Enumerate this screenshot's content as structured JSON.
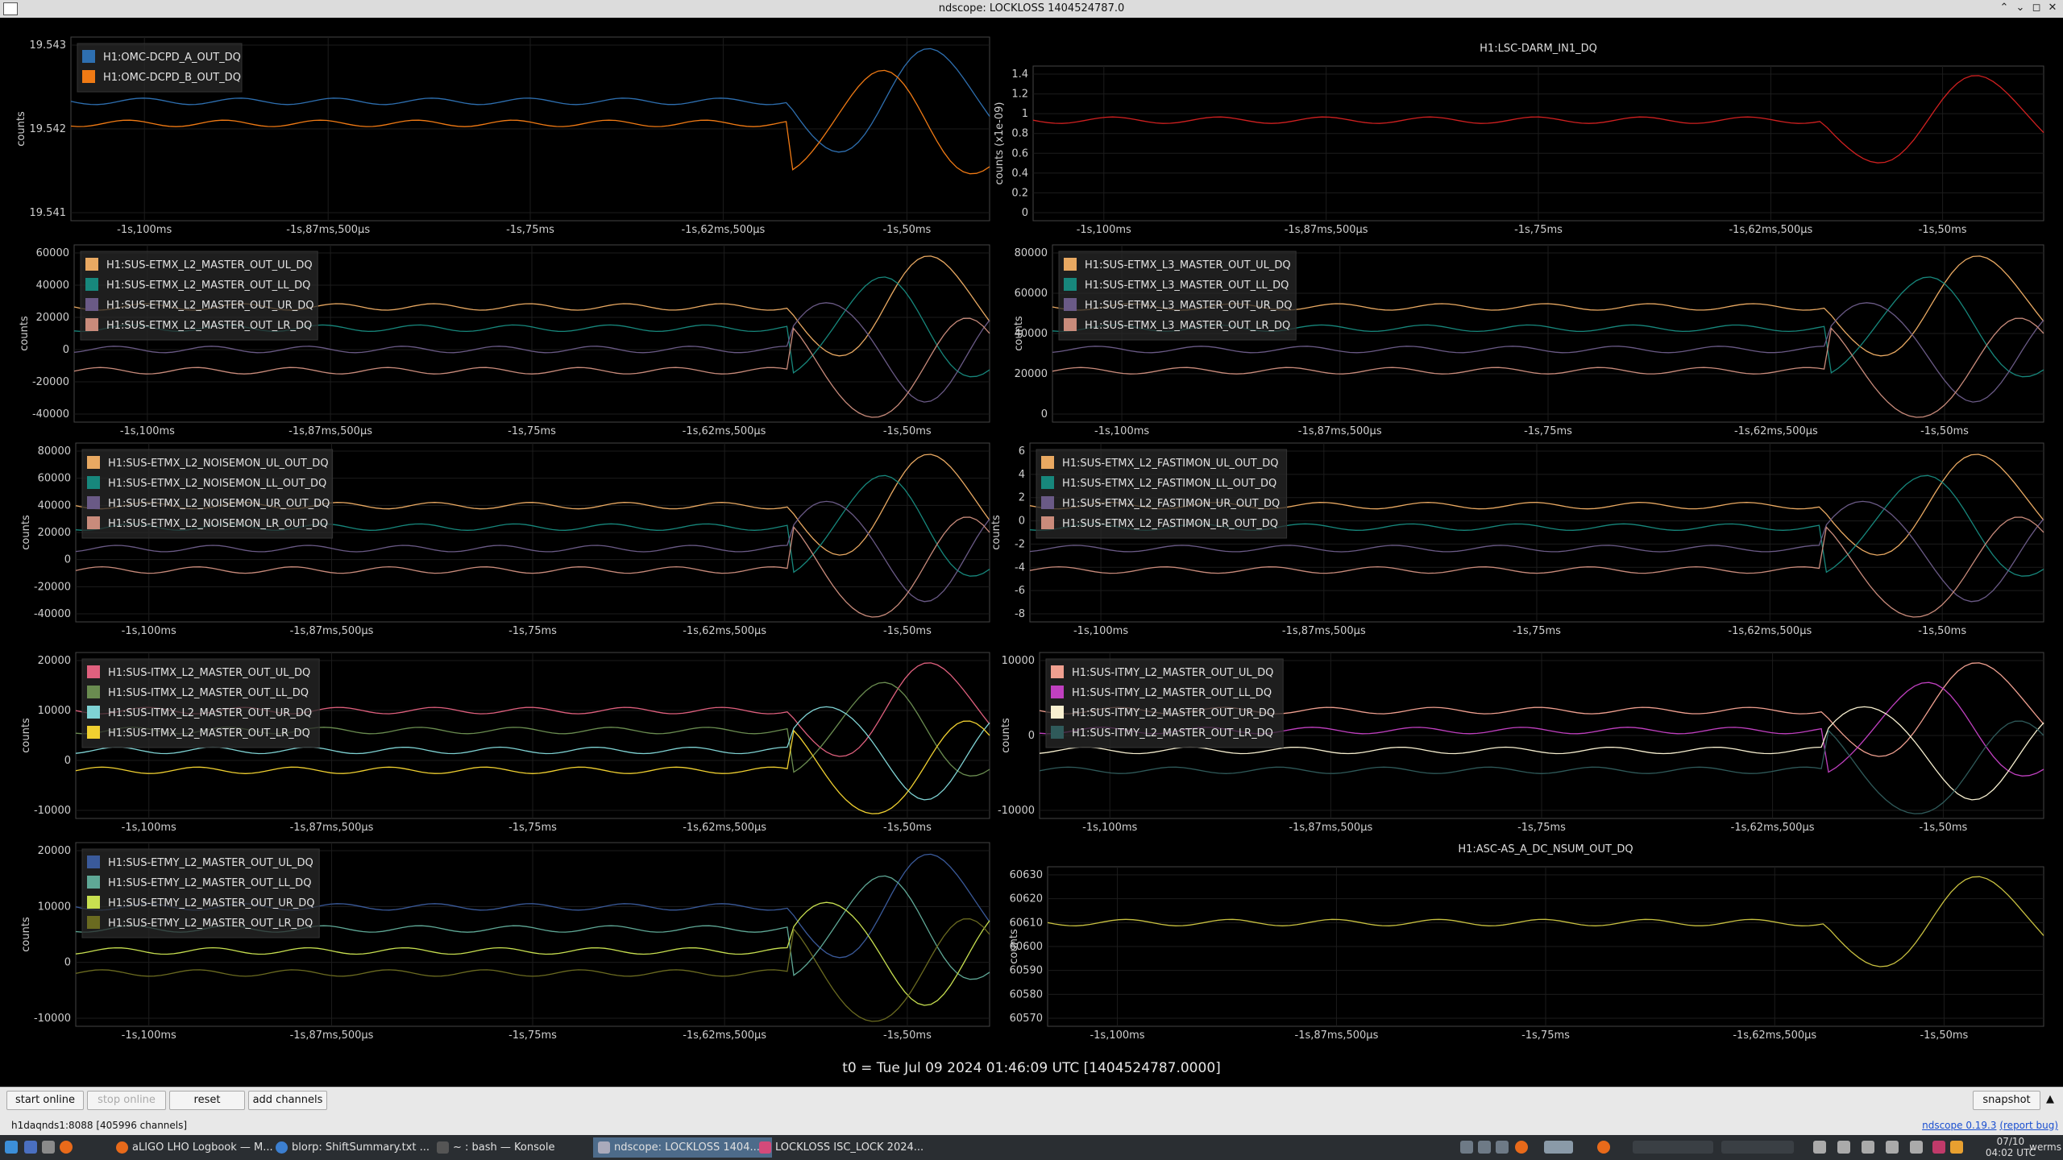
{
  "window": {
    "title": "ndscope: LOCKLOSS 1404524787.0"
  },
  "x_ticks": [
    "-1s,100ms",
    "-1s,87ms,500µs",
    "-1s,75ms",
    "-1s,62ms,500µs",
    "-1s,50ms"
  ],
  "ylabel": "counts",
  "ylabel_scaled": "counts (x1e-09)",
  "plots": [
    {
      "id": "omc-dcpd",
      "title": "",
      "ylabel": "counts",
      "yticks": [
        "19.543",
        "19.542",
        "19.541"
      ],
      "legend": [
        {
          "name": "H1:OMC-DCPD_A_OUT_DQ",
          "color": "#2e6fb0"
        },
        {
          "name": "H1:OMC-DCPD_B_OUT_DQ",
          "color": "#f07a14"
        }
      ]
    },
    {
      "id": "lsc-darm",
      "title": "H1:LSC-DARM_IN1_DQ",
      "ylabel": "counts (x1e-09)",
      "yticks": [
        "1.4",
        "1.2",
        "1",
        "0.8",
        "0.6",
        "0.4",
        "0.2",
        "0"
      ],
      "legend": []
    },
    {
      "id": "etmx-l2-master",
      "title": "",
      "ylabel": "counts",
      "yticks": [
        "60000",
        "40000",
        "20000",
        "0",
        "-20000",
        "-40000"
      ],
      "legend": [
        {
          "name": "H1:SUS-ETMX_L2_MASTER_OUT_UL_DQ",
          "color": "#e9a962"
        },
        {
          "name": "H1:SUS-ETMX_L2_MASTER_OUT_LL_DQ",
          "color": "#17877c"
        },
        {
          "name": "H1:SUS-ETMX_L2_MASTER_OUT_UR_DQ",
          "color": "#6a5a86"
        },
        {
          "name": "H1:SUS-ETMX_L2_MASTER_OUT_LR_DQ",
          "color": "#c98b7b"
        }
      ]
    },
    {
      "id": "etmx-l3-master",
      "title": "",
      "ylabel": "counts",
      "yticks": [
        "80000",
        "60000",
        "40000",
        "20000",
        "0"
      ],
      "legend": [
        {
          "name": "H1:SUS-ETMX_L3_MASTER_OUT_UL_DQ",
          "color": "#e9a962"
        },
        {
          "name": "H1:SUS-ETMX_L3_MASTER_OUT_LL_DQ",
          "color": "#17877c"
        },
        {
          "name": "H1:SUS-ETMX_L3_MASTER_OUT_UR_DQ",
          "color": "#6a5a86"
        },
        {
          "name": "H1:SUS-ETMX_L3_MASTER_OUT_LR_DQ",
          "color": "#c98b7b"
        }
      ]
    },
    {
      "id": "etmx-l2-noisemon",
      "title": "",
      "ylabel": "counts",
      "yticks": [
        "80000",
        "60000",
        "40000",
        "20000",
        "0",
        "-20000",
        "-40000"
      ],
      "legend": [
        {
          "name": "H1:SUS-ETMX_L2_NOISEMON_UL_OUT_DQ",
          "color": "#e9a962"
        },
        {
          "name": "H1:SUS-ETMX_L2_NOISEMON_LL_OUT_DQ",
          "color": "#17877c"
        },
        {
          "name": "H1:SUS-ETMX_L2_NOISEMON_UR_OUT_DQ",
          "color": "#6a5a86"
        },
        {
          "name": "H1:SUS-ETMX_L2_NOISEMON_LR_OUT_DQ",
          "color": "#c98b7b"
        }
      ]
    },
    {
      "id": "etmx-l2-fastimon",
      "title": "",
      "ylabel": "counts",
      "yticks": [
        "6",
        "4",
        "2",
        "0",
        "-2",
        "-4",
        "-6",
        "-8"
      ],
      "legend": [
        {
          "name": "H1:SUS-ETMX_L2_FASTIMON_UL_OUT_DQ",
          "color": "#e9a962"
        },
        {
          "name": "H1:SUS-ETMX_L2_FASTIMON_LL_OUT_DQ",
          "color": "#17877c"
        },
        {
          "name": "H1:SUS-ETMX_L2_FASTIMON_UR_OUT_DQ",
          "color": "#6a5a86"
        },
        {
          "name": "H1:SUS-ETMX_L2_FASTIMON_LR_OUT_DQ",
          "color": "#c98b7b"
        }
      ]
    },
    {
      "id": "itmx-l2-master",
      "title": "",
      "ylabel": "counts",
      "yticks": [
        "20000",
        "10000",
        "0",
        "-10000"
      ],
      "legend": [
        {
          "name": "H1:SUS-ITMX_L2_MASTER_OUT_UL_DQ",
          "color": "#e0607e"
        },
        {
          "name": "H1:SUS-ITMX_L2_MASTER_OUT_LL_DQ",
          "color": "#6a8c50"
        },
        {
          "name": "H1:SUS-ITMX_L2_MASTER_OUT_UR_DQ",
          "color": "#7fd3d4"
        },
        {
          "name": "H1:SUS-ITMX_L2_MASTER_OUT_LR_DQ",
          "color": "#f0d030"
        }
      ]
    },
    {
      "id": "itmy-l2-master",
      "title": "",
      "ylabel": "counts",
      "yticks": [
        "10000",
        "0",
        "-10000"
      ],
      "legend": [
        {
          "name": "H1:SUS-ITMY_L2_MASTER_OUT_UL_DQ",
          "color": "#f0a090"
        },
        {
          "name": "H1:SUS-ITMY_L2_MASTER_OUT_LL_DQ",
          "color": "#c040c0"
        },
        {
          "name": "H1:SUS-ITMY_L2_MASTER_OUT_UR_DQ",
          "color": "#f8f0d0"
        },
        {
          "name": "H1:SUS-ITMY_L2_MASTER_OUT_LR_DQ",
          "color": "#2f5a5a"
        }
      ]
    },
    {
      "id": "etmy-l2-master",
      "title": "",
      "ylabel": "counts",
      "yticks": [
        "20000",
        "10000",
        "0",
        "-10000"
      ],
      "legend": [
        {
          "name": "H1:SUS-ETMY_L2_MASTER_OUT_UL_DQ",
          "color": "#3a5a9a"
        },
        {
          "name": "H1:SUS-ETMY_L2_MASTER_OUT_LL_DQ",
          "color": "#5fa896"
        },
        {
          "name": "H1:SUS-ETMY_L2_MASTER_OUT_UR_DQ",
          "color": "#c8e050"
        },
        {
          "name": "H1:SUS-ETMY_L2_MASTER_OUT_LR_DQ",
          "color": "#6a6a20"
        }
      ]
    },
    {
      "id": "asc-as-a",
      "title": "H1:ASC-AS_A_DC_NSUM_OUT_DQ",
      "ylabel": "counts",
      "yticks": [
        "60630",
        "60620",
        "60610",
        "60600",
        "60590",
        "60580",
        "60570"
      ],
      "legend": []
    }
  ],
  "t0": "t0 = Tue Jul 09 2024 01:46:09 UTC [1404524787.0000]",
  "buttons": {
    "start_online": "start online",
    "stop_online": "stop online",
    "reset": "reset",
    "add_channels": "add channels",
    "snapshot": "snapshot"
  },
  "status": "h1daqnds1:8088  [405996 channels]",
  "version": {
    "name": "ndscope 0.19.3",
    "bug": "(report bug)"
  },
  "taskbar": {
    "tasks": [
      "aLIGO LHO Logbook — M...",
      "blorp: ShiftSummary.txt ...",
      "~ : bash — Konsole",
      "ndscope: LOCKLOSS 1404...",
      "LOCKLOSS ISC_LOCK 2024..."
    ],
    "date": "07/10",
    "time": "04:02 UTC",
    "user": "werms"
  }
}
